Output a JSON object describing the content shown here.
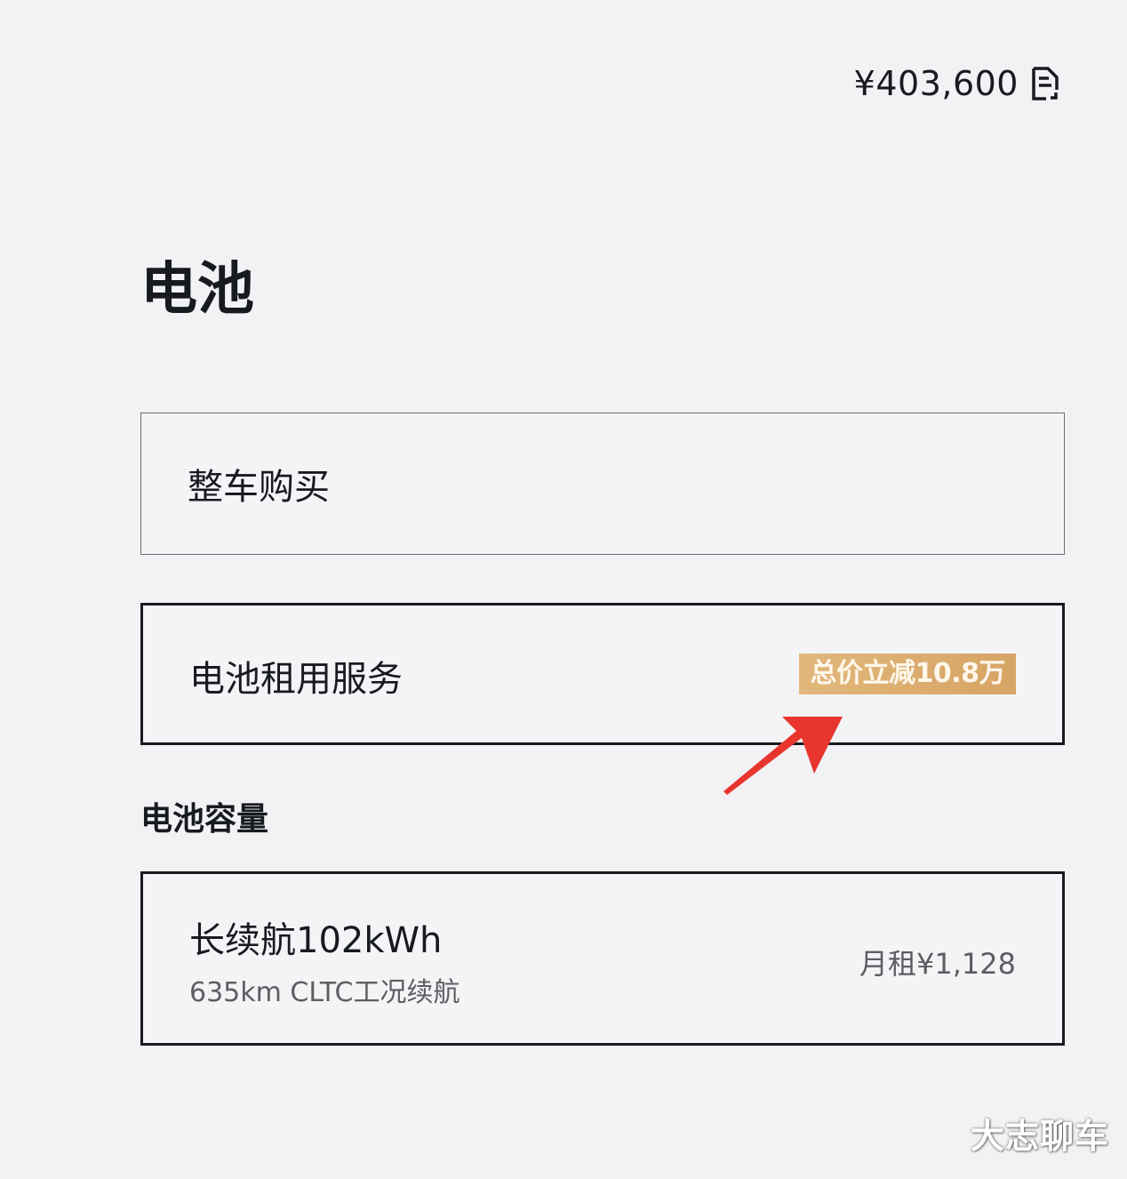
{
  "header": {
    "total_price": "¥403,600",
    "price_detail_icon": "document-icon"
  },
  "battery": {
    "title": "电池",
    "options": [
      {
        "label": "整车购买",
        "selected": false
      },
      {
        "label": "电池租用服务",
        "selected": true,
        "badge": "总价立减10.8万"
      }
    ],
    "capacity_title": "电池容量",
    "capacity_option": {
      "name": "长续航102kWh",
      "range": "635km CLTC工况续航",
      "monthly_rent": "月租¥1,128",
      "selected": true
    }
  },
  "annotation": {
    "arrow_icon": "red-arrow-icon",
    "arrow_color": "#e8352e"
  },
  "watermark": "大志聊车",
  "colors": {
    "background": "#f2f2f4",
    "text": "#171a20",
    "badge": "#dcad70"
  }
}
